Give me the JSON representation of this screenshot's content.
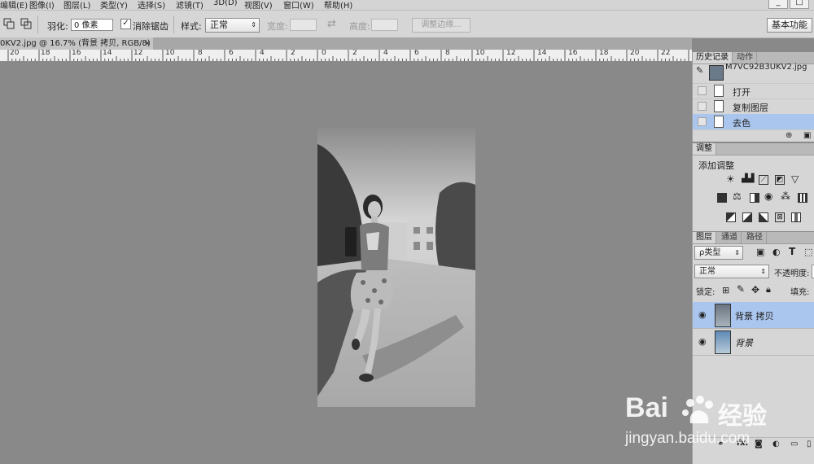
{
  "menu": {
    "items": [
      "编辑(E)",
      "图像(I)",
      "图层(L)",
      "类型(Y)",
      "选择(S)",
      "滤镜(T)",
      "3D(D)",
      "视图(V)",
      "窗口(W)",
      "帮助(H)"
    ],
    "win_min": "_",
    "win_restore": "□"
  },
  "options": {
    "feather_label": "羽化:",
    "feather_value": "0 像素",
    "antialias_check": "✓",
    "antialias_label": "消除锯齿",
    "style_label": "样式:",
    "style_value": "正常",
    "width_label": "宽度:",
    "swap_icon": "⇄",
    "height_label": "高度:",
    "refine_edge": "调整边缘...",
    "workspace": "基本功能"
  },
  "document": {
    "tab_title": "0KV2.jpg @ 16.7% (背景 拷贝, RGB/8) *",
    "close": "×"
  },
  "ruler": {
    "ticks": [
      "20",
      "18",
      "16",
      "14",
      "12",
      "10",
      "8",
      "6",
      "4",
      "2",
      "0",
      "2",
      "4",
      "6",
      "8",
      "10",
      "12",
      "14",
      "16",
      "18",
      "20",
      "22"
    ]
  },
  "history_panel": {
    "tabs": [
      "历史记录",
      "动作"
    ],
    "snapshot_name": "M7VC92B3UKV2.jpg",
    "items": [
      "打开",
      "复制图层",
      "去色"
    ]
  },
  "adjustments_panel": {
    "tab": "调整",
    "title": "添加调整"
  },
  "layers_panel": {
    "tabs": [
      "图层",
      "通道",
      "路径"
    ],
    "filter_label": "ρ类型",
    "blend_mode": "正常",
    "opacity_label": "不透明度:",
    "lock_label": "锁定:",
    "fill_label": "填充:",
    "layers": [
      {
        "name": "背景 拷贝",
        "selected": true
      },
      {
        "name": "背景",
        "selected": false
      }
    ],
    "footer_fx": "fx."
  },
  "watermark": {
    "brand": "Bai",
    "brand_suffix": "经验",
    "url": "jingyan.baidu.com"
  },
  "colors": {
    "canvas_bg": "#898989",
    "selection": "#aac6ee",
    "panel_bg": "#d6d6d6"
  }
}
